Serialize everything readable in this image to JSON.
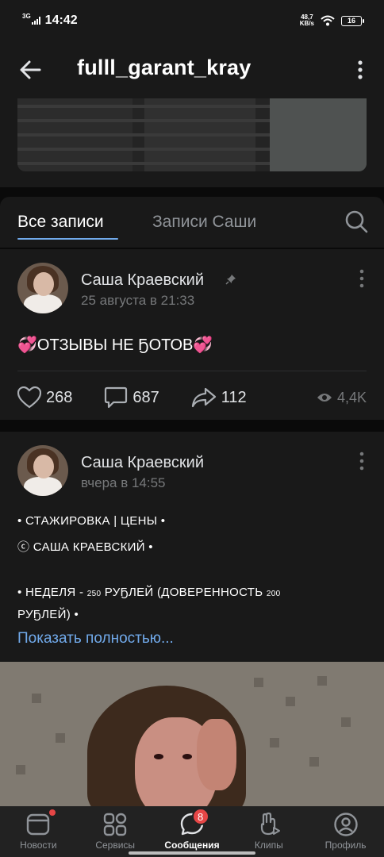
{
  "status_bar": {
    "network": "3G",
    "time": "14:42",
    "speed_value": "48,7",
    "speed_unit": "KB/s",
    "battery": "16"
  },
  "header": {
    "title": "fulll_garant_kray"
  },
  "tabs": [
    {
      "label": "Все записи",
      "active": true
    },
    {
      "label": "Записи Саши",
      "active": false
    }
  ],
  "posts": [
    {
      "author": "Саша Краевский",
      "date": "25 августа в 21:33",
      "pinned": true,
      "text": "💞ОТЗЫВЫ НЕ ҔОТОВ💞",
      "likes": "268",
      "comments": "687",
      "shares": "112",
      "views": "4,4K"
    },
    {
      "author": "Саша Краевский",
      "date": "вчера в 14:55",
      "lines": [
        {
          "a": "• СТАЖИРОВКА | ЦЕНЫ •"
        },
        {
          "a": "ⓒ САША КРАЕВСКИЙ •"
        },
        {
          "a": "• НЕДЕЛЯ - ",
          "b": "250",
          "c": " РУҔЛЕЙ (ДОВЕРЕННОСТЬ ",
          "d": "200"
        },
        {
          "a": "РУҔЛЕЙ) •"
        }
      ],
      "show_more": "Показать полностью..."
    }
  ],
  "bottom_nav": [
    {
      "label": "Новости",
      "icon": "news-icon"
    },
    {
      "label": "Сервисы",
      "icon": "services-icon"
    },
    {
      "label": "Сообщения",
      "icon": "messages-icon",
      "badge": "8",
      "active": true
    },
    {
      "label": "Клипы",
      "icon": "clips-icon"
    },
    {
      "label": "Профиль",
      "icon": "profile-icon"
    }
  ],
  "colors": {
    "accent": "#71aaeb",
    "badge": "#e64646",
    "background": "#191919"
  }
}
